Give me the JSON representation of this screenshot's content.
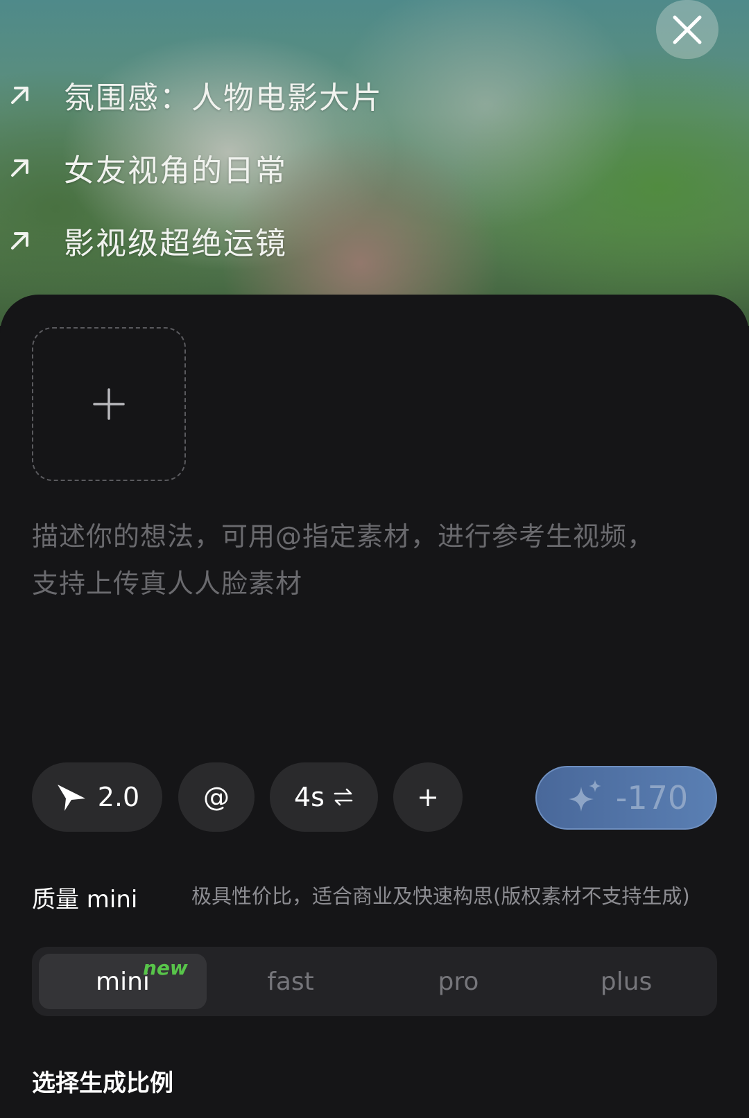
{
  "suggestions": [
    "氛围感：人物电影大片",
    "女友视角的日常",
    "影视级超绝运镜"
  ],
  "prompt": {
    "placeholder_line1": "描述你的想法，可用@指定素材，进行参考生视频，",
    "placeholder_line2": "支持上传真人人脸素材"
  },
  "toolbar": {
    "model_version": "2.0",
    "mention": "@",
    "duration": "4s",
    "add": "+",
    "generate_cost": "-170"
  },
  "quality": {
    "label": "质量 mini",
    "description": "极具性价比，适合商业及快速构思(版权素材不支持生成)",
    "options": [
      "mini",
      "fast",
      "pro",
      "plus"
    ],
    "selected": "mini",
    "new_badge": "new"
  },
  "ratio": {
    "label": "选择生成比例"
  },
  "colors": {
    "accent": "#5a7fb3",
    "new_badge": "#58c54a",
    "panel_bg": "#151517"
  }
}
